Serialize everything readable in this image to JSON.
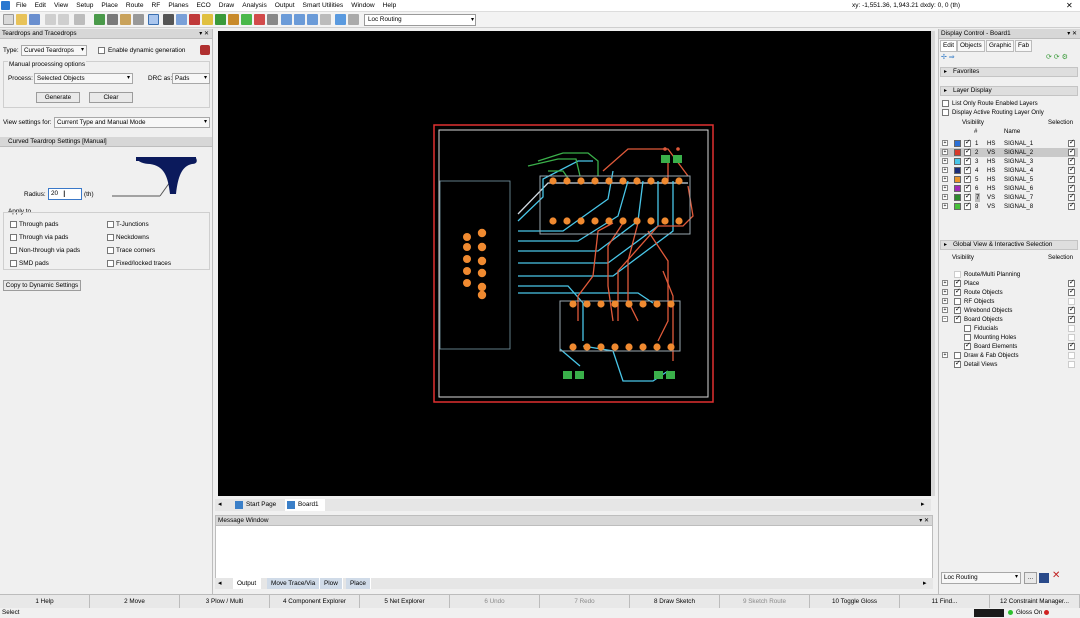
{
  "menubar": {
    "items": [
      "File",
      "Edit",
      "View",
      "Setup",
      "Place",
      "Route",
      "RF",
      "Planes",
      "ECO",
      "Draw",
      "Analysis",
      "Output",
      "Smart Utilities",
      "Window",
      "Help"
    ],
    "coords": "xy: -1,551.36, 1,943.21  dxdy: 0, 0  (th)"
  },
  "toolbar": {
    "loc_routing": "Loc Routing"
  },
  "teardrops": {
    "title": "Teardrops and Tracedrops",
    "type_label": "Type:",
    "type_value": "Curved Teardrops",
    "enable_dynamic": "Enable dynamic generation",
    "manual_options": "Manual processing options",
    "process_label": "Process:",
    "process_value": "Selected Objects",
    "drc_label": "DRC as:",
    "drc_value": "Pads",
    "generate": "Generate",
    "clear": "Clear",
    "view_settings_label": "View settings for:",
    "view_settings_value": "Current Type and Manual Mode",
    "settings_header": "Curved Teardrop Settings [Manual]",
    "radius_label": "Radius:",
    "radius_value": "20",
    "radius_unit": "(th)",
    "apply_to": "Apply to",
    "opts_left": [
      "Through pads",
      "Through via pads",
      "Non-through via pads",
      "SMD pads"
    ],
    "opts_right": [
      "T-Junctions",
      "Neckdowns",
      "Trace corners",
      "Fixed/locked traces"
    ],
    "copy_btn": "Copy to Dynamic Settings"
  },
  "canvas_tabs": {
    "start": "Start Page",
    "board": "Board1"
  },
  "message_window": {
    "title": "Message Window",
    "tabs": [
      "Output",
      "Move Trace/Via",
      "Plow",
      "Place"
    ]
  },
  "display_control": {
    "title": "Display Control - Board1",
    "tabs": [
      "Edit",
      "Objects",
      "Graphic",
      "Fab"
    ],
    "favorites": "Favorites",
    "layer_display": "Layer Display",
    "opt1": "List Only Route Enabled Layers",
    "opt2": "Display Active Routing Layer Only",
    "col_visibility": "Visibility",
    "col_selection": "Selection",
    "col_num": "#",
    "col_name": "Name",
    "layers": [
      {
        "num": "1",
        "type": "HS",
        "name": "SIGNAL_1",
        "color": "#2a6fd6"
      },
      {
        "num": "2",
        "type": "VS",
        "name": "SIGNAL_2",
        "color": "#d63a2a"
      },
      {
        "num": "3",
        "type": "HS",
        "name": "SIGNAL_3",
        "color": "#49c6e8"
      },
      {
        "num": "4",
        "type": "HS",
        "name": "SIGNAL_4",
        "color": "#1c2e7a"
      },
      {
        "num": "5",
        "type": "HS",
        "name": "SIGNAL_5",
        "color": "#e8942a"
      },
      {
        "num": "6",
        "type": "HS",
        "name": "SIGNAL_6",
        "color": "#a02ab6"
      },
      {
        "num": "7",
        "type": "VS",
        "name": "SIGNAL_7",
        "color": "#2e8b2e"
      },
      {
        "num": "8",
        "type": "VS",
        "name": "SIGNAL_8",
        "color": "#48c03a"
      }
    ],
    "global_view": "Global View & Interactive Selection",
    "gv_visibility": "Visibility",
    "gv_selection": "Selection",
    "gv_items": [
      "Route/Multi Planning",
      "Place",
      "Route Objects",
      "RF Objects",
      "Wirebond Objects",
      "Board Objects",
      "Fiducials",
      "Mounting Holes",
      "Board Elements",
      "Draw & Fab Objects",
      "Detail Views"
    ],
    "loc_routing": "Loc Routing",
    "loc_btn": "..."
  },
  "fkeys": [
    "1 Help",
    "2 Move",
    "3 Plow / Multi",
    "4 Component Explorer",
    "5 Net Explorer",
    "6 Undo",
    "7 Redo",
    "8 Draw Sketch",
    "9 Sketch Route",
    "10 Toggle Gloss",
    "11 Find...",
    "12 Constraint Manager..."
  ],
  "status": {
    "left": "Select",
    "right": "Gloss On"
  }
}
